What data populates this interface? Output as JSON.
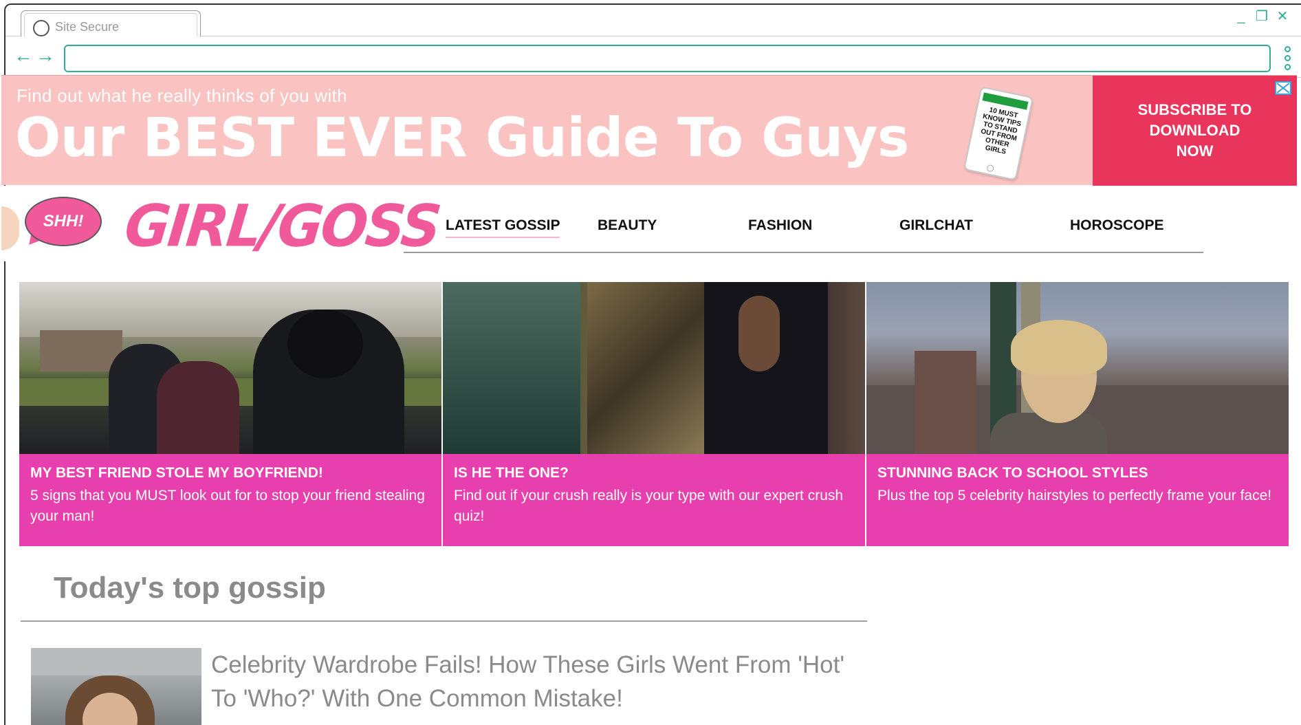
{
  "browser": {
    "tab_title": "Site Secure",
    "url_value": "",
    "controls": {
      "minimize": "_",
      "restore": "❐",
      "close": "✕"
    },
    "accent_color": "#2fae93"
  },
  "banner": {
    "kicker": "Find out what he really thinks of you with",
    "title": "Our BEST EVER Guide To Guys",
    "phone_text": "10 MUST KNOW TIPS TO STAND OUT FROM OTHER GIRLS",
    "cta": "SUBSCRIBE TO\nDOWNLOAD\nNOW",
    "background_color": "#fbc2c2",
    "cta_color": "#e9355c"
  },
  "site": {
    "bubble": "SHH!",
    "logo": "GIRL/GOSS",
    "brand_color": "#f05a9a",
    "nav": [
      {
        "label": "LATEST GOSSIP",
        "active": true
      },
      {
        "label": "BEAUTY",
        "active": false
      },
      {
        "label": "FASHION",
        "active": false
      },
      {
        "label": "GIRLCHAT",
        "active": false
      },
      {
        "label": "HOROSCOPE",
        "active": false
      }
    ]
  },
  "hero": [
    {
      "title": "MY BEST FRIEND STOLE MY BOYFRIEND!",
      "text": "5 signs that you MUST look out for to stop your friend stealing your man!"
    },
    {
      "title": "IS HE THE ONE?",
      "text": "Find out if your crush really is your type with our expert crush quiz!"
    },
    {
      "title": "STUNNING BACK TO SCHOOL STYLES",
      "text": "Plus the top 5 celebrity hairstyles to perfectly frame your face!"
    }
  ],
  "caption_color": "#e83fae",
  "top_gossip": {
    "heading": "Today's top gossip",
    "stories": [
      {
        "headline": "Celebrity Wardrobe Fails! How These Girls Went From 'Hot' To 'Who?' With One Common Mistake!"
      }
    ]
  }
}
